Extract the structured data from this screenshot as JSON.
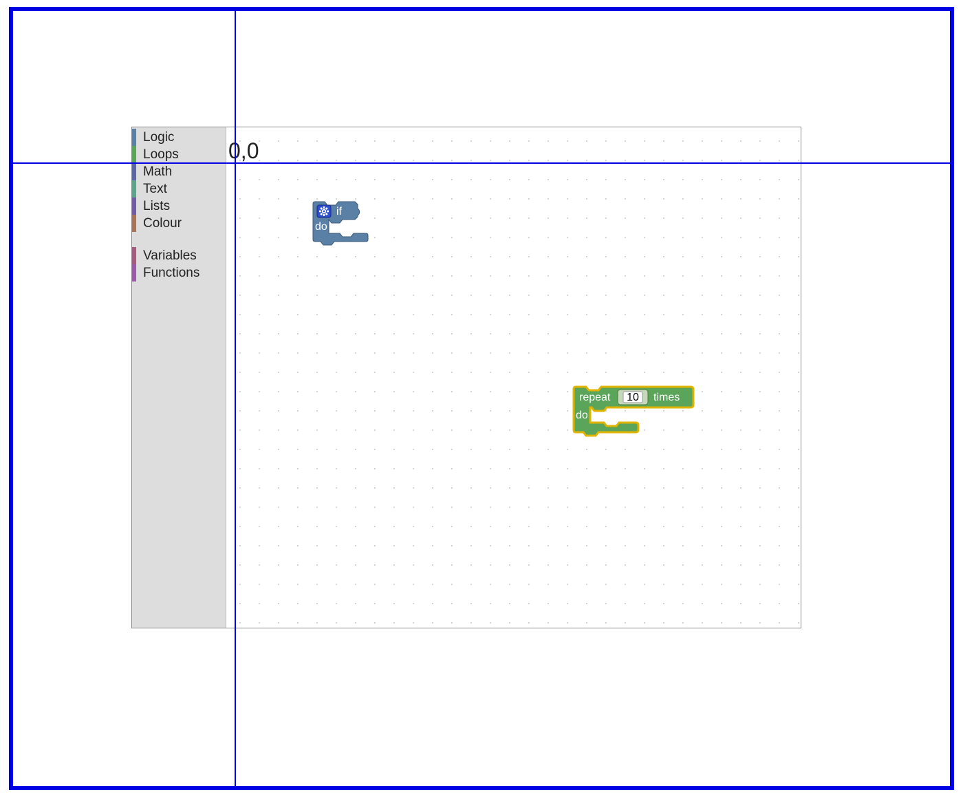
{
  "toolbox": {
    "items": [
      {
        "label": "Logic",
        "color": "#5b80a5"
      },
      {
        "label": "Loops",
        "color": "#5ba55b"
      },
      {
        "label": "Math",
        "color": "#5b67a5"
      },
      {
        "label": "Text",
        "color": "#5ba58c"
      },
      {
        "label": "Lists",
        "color": "#745ba5"
      },
      {
        "label": "Colour",
        "color": "#a5745b"
      }
    ],
    "items2": [
      {
        "label": "Variables",
        "color": "#a55b80"
      },
      {
        "label": "Functions",
        "color": "#995ba5"
      }
    ]
  },
  "canvas": {
    "origin_label": "0,0"
  },
  "blocks": {
    "if_block": {
      "mutator_icon": "gear-icon",
      "if_label": "if",
      "do_label": "do",
      "color_fill": "#5b80a5",
      "color_stroke": "#3a5a7a"
    },
    "repeat_block": {
      "repeat_label": "repeat",
      "times_label": "times",
      "do_label": "do",
      "count_value": "10",
      "color_fill": "#5ba55b",
      "color_stroke": "#c8a22a",
      "selected_outline": "#e0b400"
    }
  },
  "overlay": {
    "outer_border_color": "#0000e5",
    "crosshair_color": "#0000e5"
  }
}
